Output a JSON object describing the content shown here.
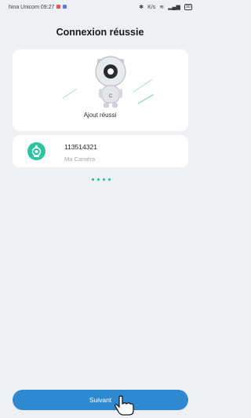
{
  "status_bar": {
    "carrier_time": "hina Unicom 09:27",
    "speed": "K/s",
    "battery": "90"
  },
  "title": "Connexion réussie",
  "success": {
    "label": "Ajout réussi"
  },
  "device": {
    "id": "113514321",
    "name": "Ma Caméra"
  },
  "progress": {
    "dot_count": 4
  },
  "button": {
    "label": "Suivant"
  },
  "colors": {
    "background": "#eff0f4",
    "accent": "#2f89d0",
    "teal": "#23c5a2",
    "card": "#ffffff"
  },
  "icons": [
    "robot-mascot-icon",
    "camera-device-icon",
    "hand-pointer-icon",
    "bluetooth-icon",
    "wifi-icon",
    "signal-icon",
    "battery-icon"
  ]
}
